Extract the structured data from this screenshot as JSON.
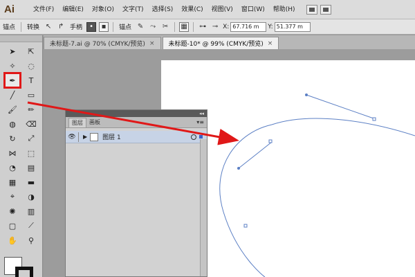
{
  "app": {
    "logo": "Ai"
  },
  "menu": [
    "文件(F)",
    "编辑(E)",
    "对象(O)",
    "文字(T)",
    "选择(S)",
    "效果(C)",
    "视图(V)",
    "窗口(W)",
    "帮助(H)"
  ],
  "control_bar": {
    "anchor_label": "锚点",
    "convert_label": "转换",
    "handle_label": "手柄",
    "anchor_label_2": "锚点",
    "x_label": "X:",
    "x_value": "67.716 m",
    "y_label": "Y:",
    "y_value": "51.377 m"
  },
  "tabs": [
    {
      "label": "未标题-7.ai @ 70% (CMYK/预览)",
      "active": false
    },
    {
      "label": "未标题-10* @ 99% (CMYK/预览)",
      "active": true
    }
  ],
  "layers_panel": {
    "tab_layers": "图层",
    "tab_artboards": "画板",
    "layer_name": "图层 1"
  },
  "annotation": {
    "color": "#e01818"
  },
  "colors": {
    "path_stroke": "#5b7fc4",
    "highlight": "#e01818"
  }
}
